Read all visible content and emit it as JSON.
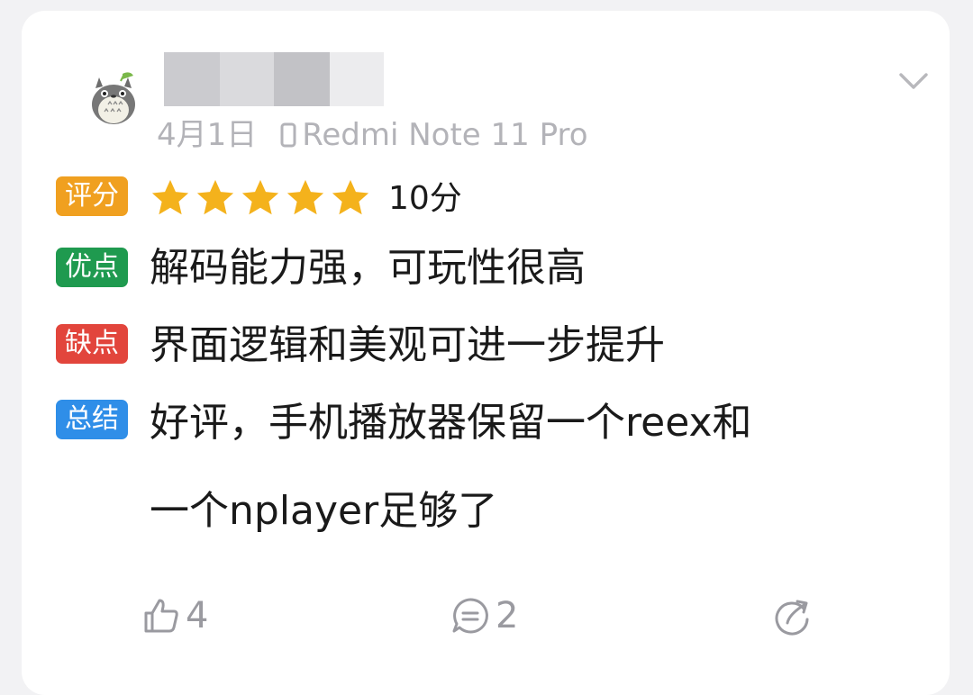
{
  "review": {
    "date": "4月1日",
    "device": "Redmi Note 11 Pro",
    "rating": {
      "label": "评分",
      "stars": 5,
      "max_stars": 5,
      "score_text": "10分"
    },
    "pros": {
      "label": "优点",
      "text": "解码能力强，可玩性很高"
    },
    "cons": {
      "label": "缺点",
      "text": "界面逻辑和美观可进一步提升"
    },
    "summary": {
      "label": "总结",
      "line1": "好评，手机播放器保留一个reex和",
      "line2": "一个nplayer足够了"
    }
  },
  "actions": {
    "likes": "4",
    "comments": "2"
  },
  "icons": {
    "expand": "chevron-down-icon",
    "device": "phone-icon",
    "star": "star-icon",
    "like": "thumbs-up-icon",
    "comment": "comment-icon",
    "share": "share-icon",
    "avatar": "totoro-avatar"
  },
  "colors": {
    "rating_tag": "#f0a020",
    "pros_tag": "#1f9a4f",
    "cons_tag": "#e2453c",
    "summary_tag": "#2f8ee8",
    "star": "#f4b21c"
  }
}
